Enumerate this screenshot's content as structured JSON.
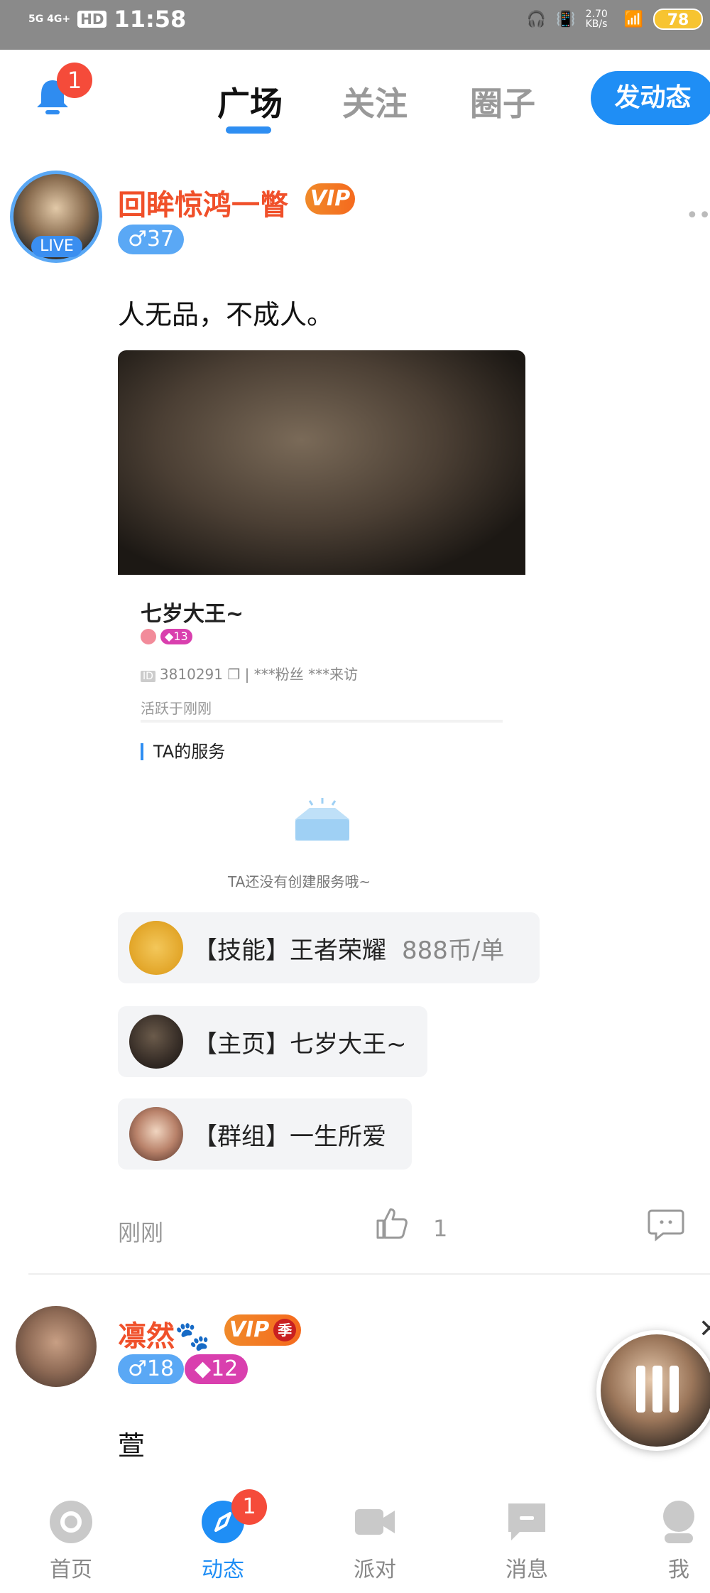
{
  "status_bar": {
    "network": "5G 4G+",
    "hd": "HD",
    "time": "11:58",
    "net_speed": "2.70 KB/s",
    "battery": "78"
  },
  "top_nav": {
    "bell_badge": "1",
    "tabs": [
      {
        "label": "广场",
        "active": true
      },
      {
        "label": "关注",
        "active": false
      },
      {
        "label": "圈子",
        "active": false
      }
    ],
    "post_button": "发动态"
  },
  "post1": {
    "live_label": "LIVE",
    "username": "回眸惊鸿一瞥",
    "vip": "VIP",
    "level": "37",
    "text": "人无品，不成人。",
    "card": {
      "name": "七岁大王~",
      "level": "13",
      "id_line": "3810291 ❐ | ***粉丝 ***来访",
      "active": "活跃于刚刚",
      "service_title": "TA的服务",
      "empty_text": "TA还没有创建服务哦~"
    },
    "chips": [
      {
        "text": "【技能】王者荣耀",
        "price": "888币/单"
      },
      {
        "text": "【主页】七岁大王~"
      },
      {
        "text": "【群组】一生所爱"
      }
    ],
    "time": "刚刚",
    "likes": "1"
  },
  "post2": {
    "username": "凛然🐾",
    "vip": "VIP",
    "vip_suffix": "季",
    "level": "18",
    "badge": "12",
    "text": "萱"
  },
  "bottom_nav": [
    {
      "label": "首页",
      "icon": "home-icon"
    },
    {
      "label": "动态",
      "icon": "compass-icon",
      "badge": "1",
      "active": true
    },
    {
      "label": "派对",
      "icon": "video-icon"
    },
    {
      "label": "消息",
      "icon": "message-icon"
    },
    {
      "label": "我",
      "icon": "profile-icon"
    }
  ],
  "colors": {
    "accent": "#1f8ef5",
    "username": "#f0502a",
    "badge": "#f54b3a"
  }
}
